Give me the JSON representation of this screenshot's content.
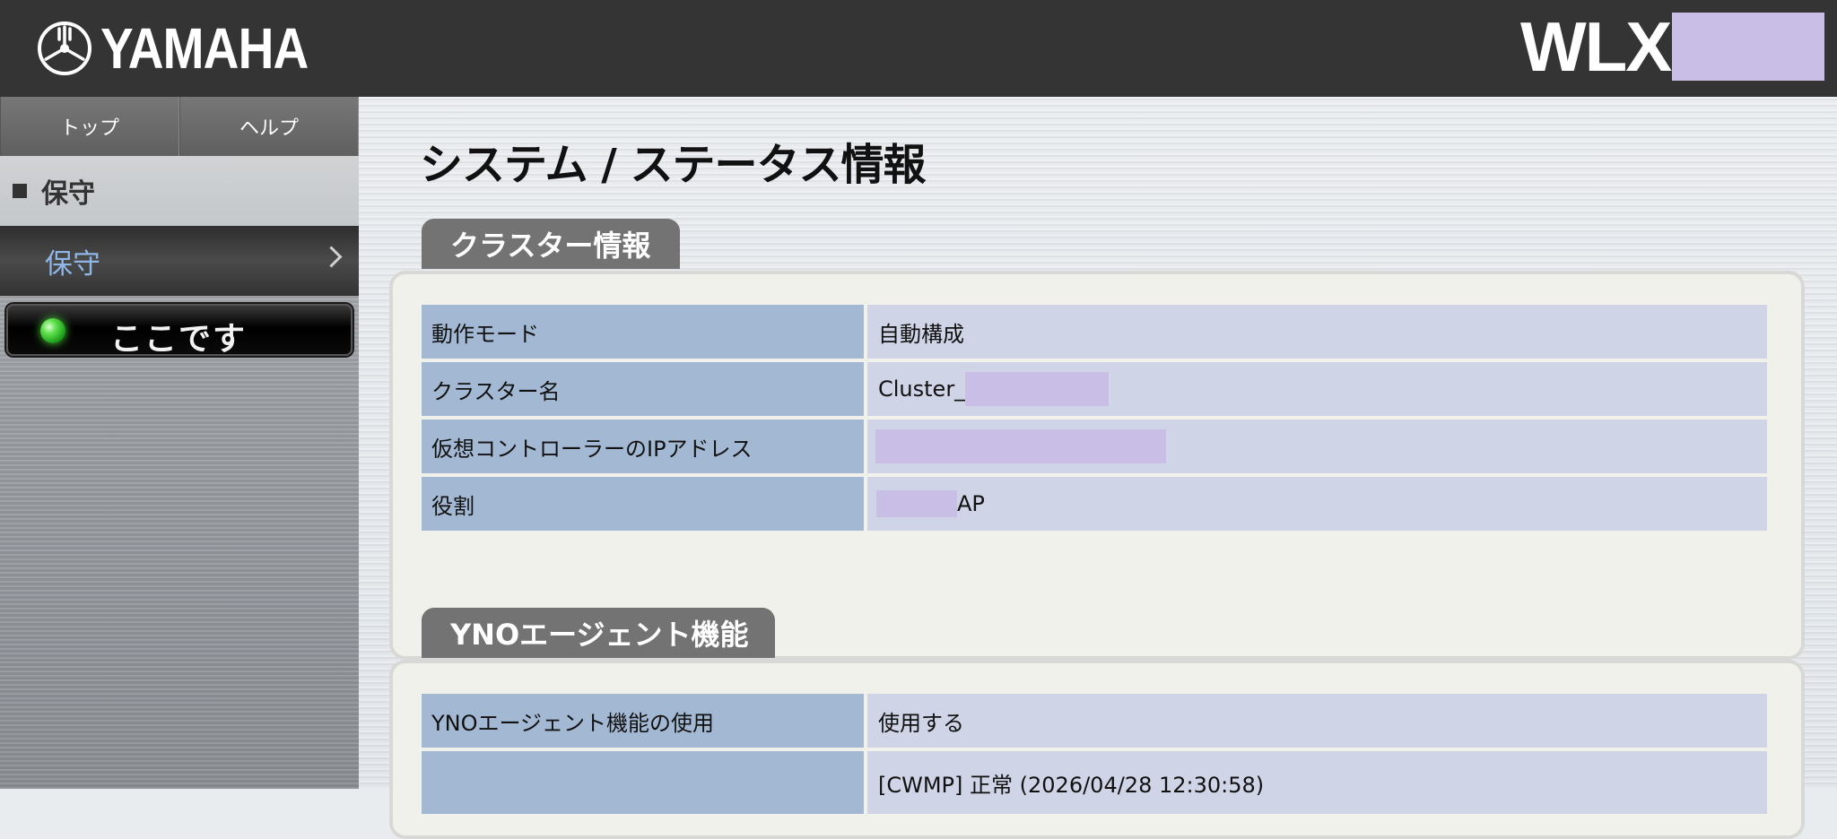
{
  "header": {
    "brand": "YAMAHA",
    "model_prefix": "WLX"
  },
  "sidebar": {
    "nav": [
      {
        "label": "トップ"
      },
      {
        "label": "ヘルプ"
      }
    ],
    "section_title": "保守",
    "menu_item_label": "保守",
    "here_button_label": "ここです"
  },
  "main": {
    "page_title": "システム / ステータス情報",
    "cluster": {
      "tab_label": "クラスター情報",
      "rows": [
        {
          "label": "動作モード",
          "value": "自動構成"
        },
        {
          "label": "クラスター名",
          "value_prefix": "Cluster_"
        },
        {
          "label": "仮想コントローラーのIPアドレス"
        },
        {
          "label": "役割",
          "value_suffix": "AP"
        }
      ]
    },
    "yno": {
      "tab_label": "YNOエージェント機能",
      "rows": [
        {
          "label": "YNOエージェント機能の使用",
          "value": "使用する"
        },
        {
          "label": "",
          "value": "[CWMP] 正常 (2026/04/28 12:30:58)"
        }
      ]
    }
  },
  "colors": {
    "header_bg": "#343434",
    "redaction": "#c9bfe6",
    "label_cell": "#a3b8d3",
    "value_cell": "#cfd4e6",
    "menu_link": "#8fb6e6",
    "led_green": "#5fe04c"
  }
}
